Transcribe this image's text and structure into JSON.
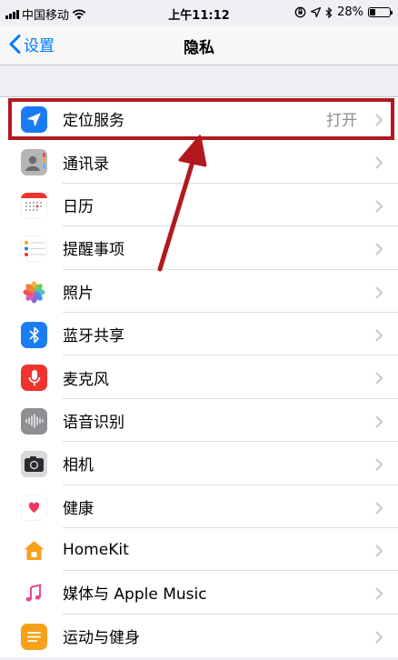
{
  "status_bar": {
    "carrier": "中国移动",
    "time": "上午11:12",
    "battery_percent": "28%",
    "battery_level": 0.28
  },
  "nav": {
    "back_label": "设置",
    "title": "隐私"
  },
  "rows": [
    {
      "label": "定位服务",
      "value": "打开",
      "icon": "location-arrow-icon",
      "color": "#1a7cf5"
    },
    {
      "label": "通讯录",
      "value": "",
      "icon": "contacts-icon",
      "color": "#a0a0a0"
    },
    {
      "label": "日历",
      "value": "",
      "icon": "calendar-icon",
      "color": "#ffffff"
    },
    {
      "label": "提醒事项",
      "value": "",
      "icon": "reminders-icon",
      "color": "#ffffff"
    },
    {
      "label": "照片",
      "value": "",
      "icon": "photos-icon",
      "color": "#ffffff"
    },
    {
      "label": "蓝牙共享",
      "value": "",
      "icon": "bluetooth-icon",
      "color": "#1a7cf5"
    },
    {
      "label": "麦克风",
      "value": "",
      "icon": "microphone-icon",
      "color": "#f0332f"
    },
    {
      "label": "语音识别",
      "value": "",
      "icon": "speech-recognition-icon",
      "color": "#8e8e93"
    },
    {
      "label": "相机",
      "value": "",
      "icon": "camera-icon",
      "color": "#6e6e73"
    },
    {
      "label": "健康",
      "value": "",
      "icon": "health-heart-icon",
      "color": "#ffffff"
    },
    {
      "label": "HomeKit",
      "value": "",
      "icon": "homekit-icon",
      "color": "#ffffff"
    },
    {
      "label": "媒体与 Apple Music",
      "value": "",
      "icon": "music-note-icon",
      "color": "#ffffff"
    },
    {
      "label": "运动与健身",
      "value": "",
      "icon": "motion-fitness-icon",
      "color": "#f7a11b"
    }
  ],
  "annotation": {
    "color": "#b1191f"
  }
}
